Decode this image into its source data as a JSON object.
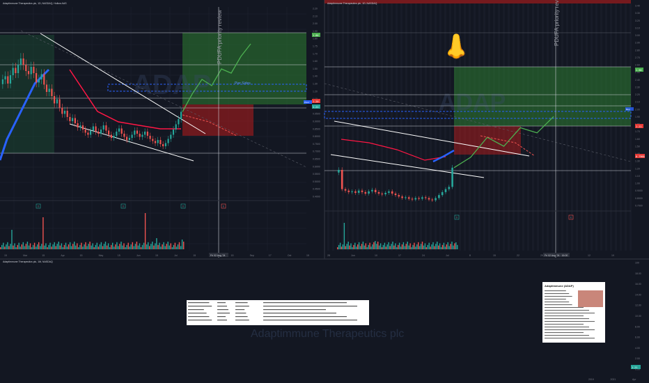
{
  "colors": {
    "bg": "#131722",
    "grid": "#1e2230",
    "up": "#26a69a",
    "down": "#ef5350",
    "axis": "#787b86",
    "target": "#4caf50",
    "stop": "#e53935",
    "white": "#d1d4dc",
    "blue": "#2962ff",
    "sma": "#ff1744"
  },
  "panels": [
    {
      "id": "left",
      "header": "Adaptimmune Therapeutics plc, 1D, NASDAQ, Hollow AAS",
      "pdufa": "PDUFA priority review",
      "date_label": "Fri 02 Aug '24",
      "price_labels": [
        "2.20",
        "2.10",
        "2.00",
        "1.90",
        "1.80",
        "1.75",
        "1.70",
        "1.60",
        "1.50",
        "1.40",
        "1.30",
        "1.20",
        "1.10",
        "1.00",
        "0.9500",
        "0.9000",
        "0.8500",
        "0.8000",
        "0.7500",
        "0.7000",
        "0.6500",
        "0.6000",
        "0.5500",
        "0.5000",
        "0.4500",
        "0.4000"
      ],
      "badges": {
        "target": "1.86",
        "stop": "1.20",
        "current": "1.21",
        "pivot": "Pivot"
      },
      "x_ticks": [
        "15",
        "Mar",
        "15",
        "Apr",
        "15",
        "May",
        "15",
        "Jun",
        "15",
        "Jul",
        "15",
        "Aug",
        "15",
        "Sep",
        "17",
        "Oct",
        "15"
      ],
      "annotation": "Pier Sides",
      "watermark": "ADAP",
      "marker_letters": [
        "D",
        "D",
        "D",
        "E"
      ],
      "chart_data": {
        "type": "candlestick",
        "ylim": [
          0.4,
          2.2
        ],
        "series": [
          {
            "values": [
              1.52,
              1.55,
              1.48,
              1.56,
              1.63,
              1.58,
              1.66,
              1.72,
              1.66,
              1.6,
              1.57,
              1.64,
              1.58,
              1.49,
              1.52,
              1.57,
              1.47,
              1.4,
              1.43,
              1.36,
              1.29,
              1.33,
              1.25,
              1.19,
              1.22,
              1.16,
              1.12,
              1.15,
              1.1,
              1.06,
              1.08,
              1.04,
              1.01,
              0.99,
              1.03,
              1.07,
              1.02,
              1.0,
              1.04,
              1.08,
              1.03,
              0.99,
              0.96,
              0.98,
              1.02,
              1.05,
              1.0,
              0.97,
              0.94,
              0.96,
              0.99,
              1.03,
              1.0,
              0.97,
              0.99,
              1.02,
              0.98,
              0.95,
              0.93,
              0.91,
              0.94,
              0.9,
              0.88,
              0.91,
              0.95,
              0.99,
              1.04,
              1.09,
              1.14,
              1.21
            ]
          }
        ],
        "projection": [
          1.21,
          1.38,
          1.52,
          1.46,
          1.62,
          1.58,
          1.74,
          1.86
        ],
        "target_zone": [
          1.2,
          1.86
        ],
        "stop_zone": [
          0.98,
          1.2
        ]
      }
    },
    {
      "id": "right",
      "header": "Adaptimmune Therapeutics plc, 1D, NASDAQ",
      "pdufa": "PDUFA priority review",
      "date_label": "Fri 02 Aug '24 · 16:00",
      "price_labels": [
        "3.40",
        "3.30",
        "3.20",
        "3.10",
        "3.00",
        "2.90",
        "2.80",
        "2.70",
        "2.60",
        "2.50",
        "2.40",
        "2.30",
        "2.20",
        "2.10",
        "2.00",
        "1.90",
        "1.80",
        "1.70",
        "1.60",
        "1.50",
        "1.40",
        "1.30",
        "1.20",
        "1.10",
        "1.00",
        "0.9000",
        "0.8000",
        "0.7000"
      ],
      "badges": {
        "target": "1.90",
        "stop": "0.7900",
        "current": "1.21",
        "pivot": "Rep"
      },
      "x_ticks": [
        "28",
        "Jun",
        "10",
        "17",
        "24",
        "Jul",
        "8",
        "15",
        "22",
        "29",
        "Aug",
        "12",
        "19"
      ],
      "watermark": "ADAP",
      "emoji": "👃",
      "marker_letters": [
        "D",
        "E"
      ],
      "chart_data": {
        "type": "candlestick",
        "ylim": [
          0.7,
          3.4
        ],
        "series": [
          {
            "values": [
              1.18,
              0.92,
              0.9,
              0.88,
              0.89,
              0.87,
              0.9,
              0.88,
              0.86,
              0.89,
              0.91,
              0.88,
              0.86,
              0.85,
              0.87,
              0.89,
              0.86,
              0.84,
              0.82,
              0.8,
              0.81,
              0.79,
              0.78,
              0.8,
              0.79,
              0.81,
              0.8,
              0.78,
              0.77,
              0.8,
              0.84,
              0.88,
              0.92,
              0.95,
              1.21
            ]
          }
        ],
        "projection": [
          1.21,
          1.35,
          1.62,
          1.5,
          1.75,
          1.68,
          1.9
        ]
      }
    }
  ],
  "bottom": {
    "header": "Adaptimmune Therapeutics plc, 1M, NASDAQ",
    "watermark": "Adaptimmune Therapeutics plc",
    "price_labels": [
      "100",
      "18.00",
      "16.00",
      "14.00",
      "12.00",
      "10.00",
      "8.00",
      "6.00",
      "4.00",
      "2.00",
      "0.00"
    ],
    "x_ticks": [
      "2019",
      "2021",
      "Apr"
    ],
    "card_title": "Adaptimmune (ADAP)",
    "current": "1.21"
  }
}
